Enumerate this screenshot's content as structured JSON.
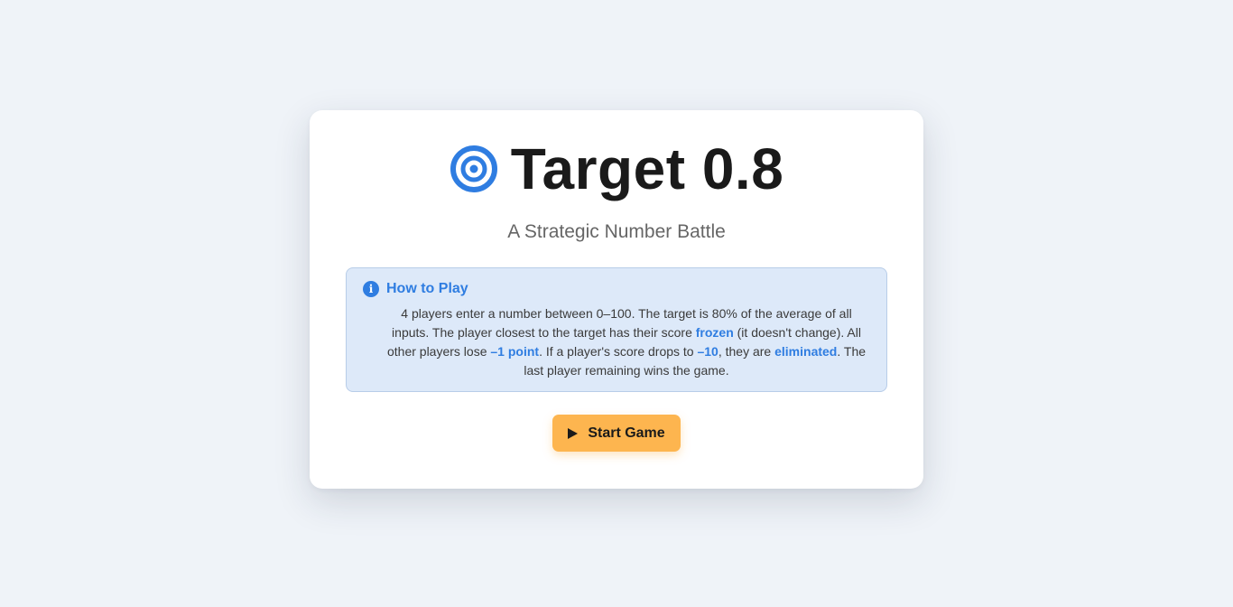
{
  "game": {
    "title": "Target 0.8",
    "subtitle": "A Strategic Number Battle"
  },
  "how_to_play": {
    "heading": "How to Play",
    "text_part1": "4 players enter a number between 0–100. The target is 80% of the average of all inputs. The player closest to the target has their score ",
    "highlight_frozen": "frozen",
    "text_part2": " (it doesn't change). All other players lose ",
    "highlight_penalty": "–1 point",
    "text_part3": ". If a player's score drops to ",
    "highlight_limit": "–10",
    "text_part4": ", they are ",
    "highlight_eliminated": "eliminated",
    "text_part5": ". The last player remaining wins the game."
  },
  "actions": {
    "start_label": "Start Game"
  },
  "icons": {
    "title_icon": "target-icon",
    "info": "info-icon",
    "start": "play-icon"
  },
  "colors": {
    "accent_blue": "#2f7de1",
    "button_orange": "#fdb54f",
    "info_bg": "#dde9f9",
    "page_bg": "#eff3f8"
  }
}
